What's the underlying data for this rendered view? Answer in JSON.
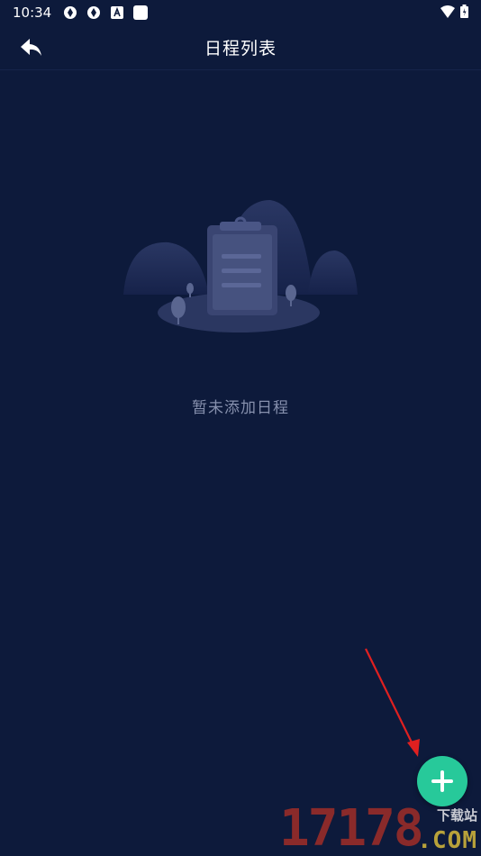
{
  "status_bar": {
    "time": "10:34",
    "icons": [
      "sync-icon",
      "sync-icon",
      "a-icon",
      "square-icon"
    ],
    "right_icons": [
      "wifi-icon",
      "battery-icon"
    ]
  },
  "header": {
    "title": "日程列表",
    "back_icon": "back-arrow-icon"
  },
  "empty_state": {
    "message": "暂未添加日程"
  },
  "fab": {
    "icon": "plus-icon",
    "color": "#27c99a"
  },
  "watermark": {
    "number": "17178",
    "site_label": "下载站",
    "domain": ".COM"
  },
  "colors": {
    "background": "#0d1a3b",
    "accent": "#27c99a",
    "annotation_arrow": "#e02020"
  }
}
